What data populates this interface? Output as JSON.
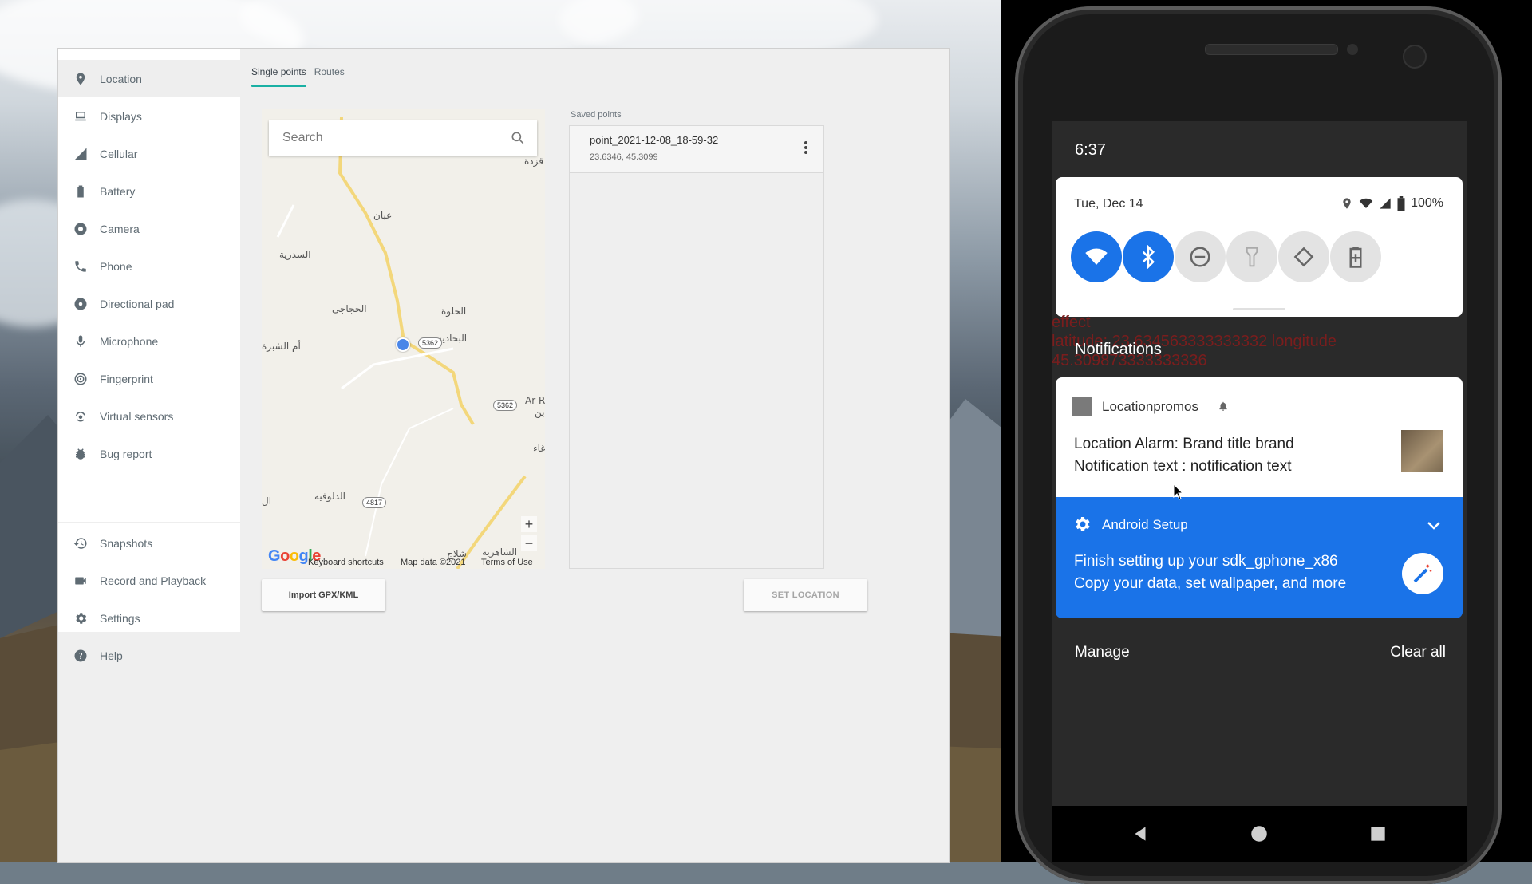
{
  "emulator": {
    "sidebar": {
      "items": [
        {
          "label": "Location",
          "icon": "location-pin-icon"
        },
        {
          "label": "Displays",
          "icon": "display-icon"
        },
        {
          "label": "Cellular",
          "icon": "cellular-signal-icon"
        },
        {
          "label": "Battery",
          "icon": "battery-icon"
        },
        {
          "label": "Camera",
          "icon": "camera-aperture-icon"
        },
        {
          "label": "Phone",
          "icon": "phone-icon"
        },
        {
          "label": "Directional pad",
          "icon": "dpad-icon"
        },
        {
          "label": "Microphone",
          "icon": "microphone-icon"
        },
        {
          "label": "Fingerprint",
          "icon": "fingerprint-icon"
        },
        {
          "label": "Virtual sensors",
          "icon": "rotation-icon"
        },
        {
          "label": "Bug report",
          "icon": "bug-icon"
        },
        {
          "label": "Snapshots",
          "icon": "history-icon"
        },
        {
          "label": "Record and Playback",
          "icon": "videocam-icon"
        },
        {
          "label": "Settings",
          "icon": "gear-icon"
        },
        {
          "label": "Help",
          "icon": "help-icon"
        }
      ],
      "active": "Location"
    },
    "tabs": [
      "Single points",
      "Routes"
    ],
    "search": {
      "placeholder": "Search"
    },
    "map": {
      "labels": [
        "قزدة",
        "عبان",
        "السدرية",
        "الحجاجي",
        "الحلوة",
        "البحادية",
        "أم الشبرة",
        "Ar R",
        "بن",
        "غاء",
        "الدلوفية",
        "ال",
        "الشاهرية",
        "شلاج"
      ],
      "road_shields": [
        "5362",
        "5362",
        "4817"
      ],
      "attribution": {
        "keyboard": "Keyboard shortcuts",
        "mapdata": "Map data ©2021",
        "terms": "Terms of Use",
        "logo": "Google"
      },
      "zoom_in": "+",
      "zoom_out": "−"
    },
    "saved_points": {
      "label": "Saved points",
      "items": [
        {
          "name": "point_2021-12-08_18-59-32",
          "coords": "23.6346, 45.3099"
        }
      ]
    },
    "buttons": {
      "import": "Import GPX/KML",
      "set_location": "SET LOCATION"
    }
  },
  "phone": {
    "clock": "6:37",
    "quick_settings": {
      "date": "Tue, Dec 14",
      "battery": "100%",
      "tiles": [
        {
          "name": "wifi",
          "state": "on"
        },
        {
          "name": "bluetooth",
          "state": "on"
        },
        {
          "name": "do-not-disturb",
          "state": "off"
        },
        {
          "name": "flashlight",
          "state": "off"
        },
        {
          "name": "auto-rotate",
          "state": "off"
        },
        {
          "name": "battery-saver",
          "state": "off"
        }
      ]
    },
    "bleed_text": {
      "l1": "effect",
      "l2": "latitude: 23.634563333333332 longitude",
      "l3": "45.309873333333336"
    },
    "notifications_header": "Notifications",
    "notification_1": {
      "app": "Locationpromos",
      "title": "Location Alarm: Brand title brand",
      "text": "Notification text :  notification text"
    },
    "notification_2": {
      "app": "Android Setup",
      "title": "Finish setting up your sdk_gphone_x86",
      "text": "Copy your data, set wallpaper, and more"
    },
    "actions": {
      "manage": "Manage",
      "clear_all": "Clear all"
    },
    "colors": {
      "accent": "#1a73e8",
      "teal_tab": "#1ab0a4"
    }
  }
}
